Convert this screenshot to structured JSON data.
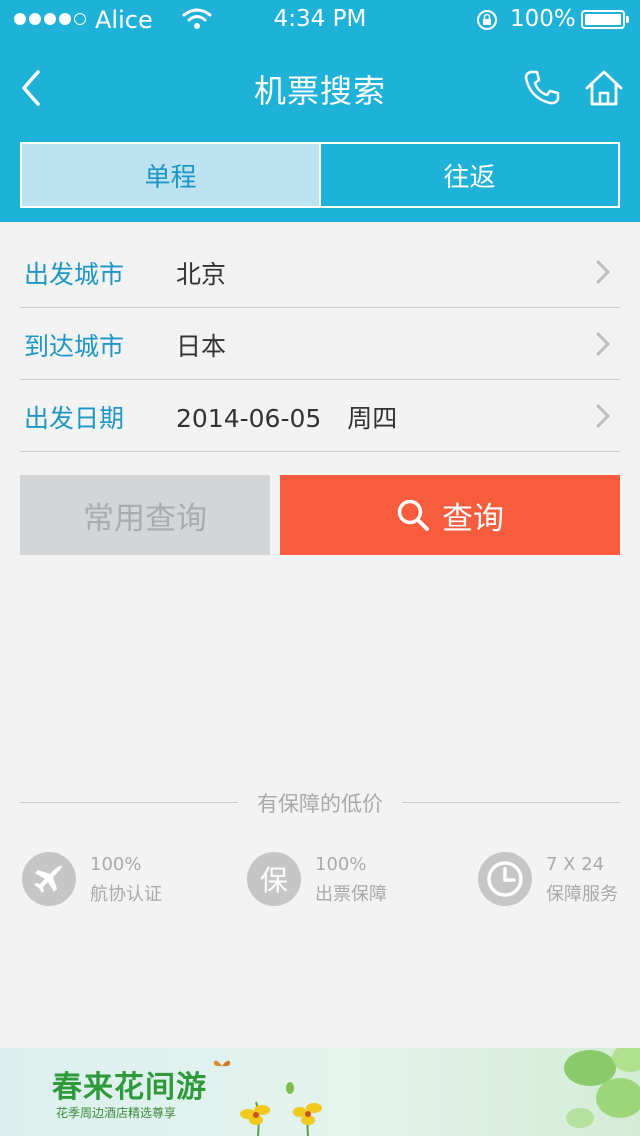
{
  "status_bar": {
    "carrier": "Alice",
    "time": "4:34 PM",
    "battery": "100%"
  },
  "nav": {
    "title": "机票搜索",
    "back_icon": "chevron-left-icon",
    "phone_icon": "phone-icon",
    "home_icon": "home-icon"
  },
  "trip_tabs": {
    "one_way": "单程",
    "round_trip": "往返",
    "selected": "单程"
  },
  "form": {
    "departure_city": {
      "label": "出发城市",
      "value": "北京"
    },
    "arrival_city": {
      "label": "到达城市",
      "value": "日本"
    },
    "departure_date": {
      "label": "出发日期",
      "value": "2014-06-05",
      "weekday": "周四"
    }
  },
  "buttons": {
    "common_query": "常用查询",
    "search": "查询"
  },
  "guarantee": {
    "title": "有保障的低价",
    "items": [
      {
        "icon": "airplane-icon",
        "top": "100%",
        "bottom": "航协认证"
      },
      {
        "icon": "guarantee-badge-icon",
        "badge_text": "保",
        "top": "100%",
        "bottom": "出票保障"
      },
      {
        "icon": "clock-icon",
        "top": "7 X 24",
        "bottom": "保障服务"
      }
    ]
  },
  "banner": {
    "title": "春来花间游",
    "subtitle": "花季周边酒店精选尊享"
  },
  "colors": {
    "header": "#1fb2d9",
    "label": "#1d97c5",
    "search_button": "#f75c3c",
    "common_button": "#d3d5d7"
  }
}
